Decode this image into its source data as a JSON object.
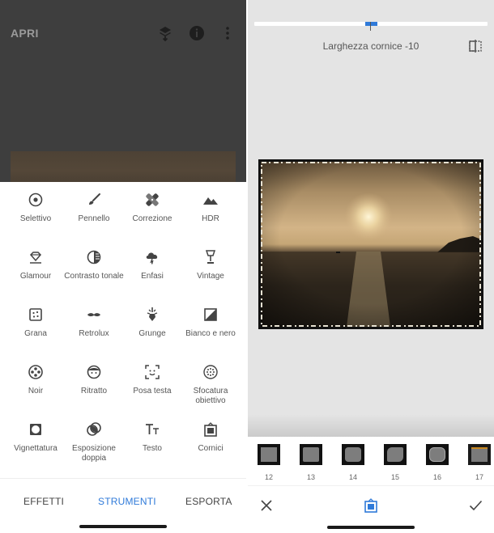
{
  "left": {
    "appbar": {
      "open_label": "APRI",
      "icons": [
        "layers-icon",
        "info-icon",
        "more-vert-icon"
      ]
    },
    "tools": [
      {
        "label": "Selettivo",
        "icon": "target-icon"
      },
      {
        "label": "Pennello",
        "icon": "brush-icon"
      },
      {
        "label": "Correzione",
        "icon": "healing-bandage-icon"
      },
      {
        "label": "HDR",
        "icon": "mountains-icon"
      },
      {
        "label": "Glamour",
        "icon": "diamond-glow-icon"
      },
      {
        "label": "Contrasto tonale",
        "icon": "half-circle-icon"
      },
      {
        "label": "Enfasi",
        "icon": "cloud-bolt-icon"
      },
      {
        "label": "Vintage",
        "icon": "lamp-icon"
      },
      {
        "label": "Grana",
        "icon": "grain-square-icon"
      },
      {
        "label": "Retrolux",
        "icon": "mustache-icon"
      },
      {
        "label": "Grunge",
        "icon": "guitar-icon"
      },
      {
        "label": "Bianco e nero",
        "icon": "mountain-square-icon"
      },
      {
        "label": "Noir",
        "icon": "film-reel-icon"
      },
      {
        "label": "Ritratto",
        "icon": "face-icon"
      },
      {
        "label": "Posa testa",
        "icon": "face-frame-icon"
      },
      {
        "label": "Sfocatura obiettivo",
        "icon": "lens-blur-icon"
      },
      {
        "label": "Vignettatura",
        "icon": "vignette-icon"
      },
      {
        "label": "Esposizione doppia",
        "icon": "double-exposure-icon"
      },
      {
        "label": "Testo",
        "icon": "text-tt-icon"
      },
      {
        "label": "Cornici",
        "icon": "frame-icon"
      }
    ],
    "bottom_tabs": {
      "effects": "EFFETTI",
      "tools": "STRUMENTI",
      "export": "ESPORTA"
    },
    "colors": {
      "accent": "#2f7ad9",
      "topbar_bg": "#3e3e3e"
    }
  },
  "right": {
    "slider": {
      "label": "Larghezza cornice -10",
      "value": -10
    },
    "frame_thumbnails": [
      {
        "number": "12"
      },
      {
        "number": "13"
      },
      {
        "number": "14"
      },
      {
        "number": "15"
      },
      {
        "number": "16"
      },
      {
        "number": "17"
      }
    ],
    "actions": {
      "cancel_icon": "close-icon",
      "tool_icon": "frame-icon",
      "apply_icon": "check-icon"
    },
    "colors": {
      "accent": "#2f7ad9",
      "canvas_bg": "#e4e4e4"
    }
  }
}
